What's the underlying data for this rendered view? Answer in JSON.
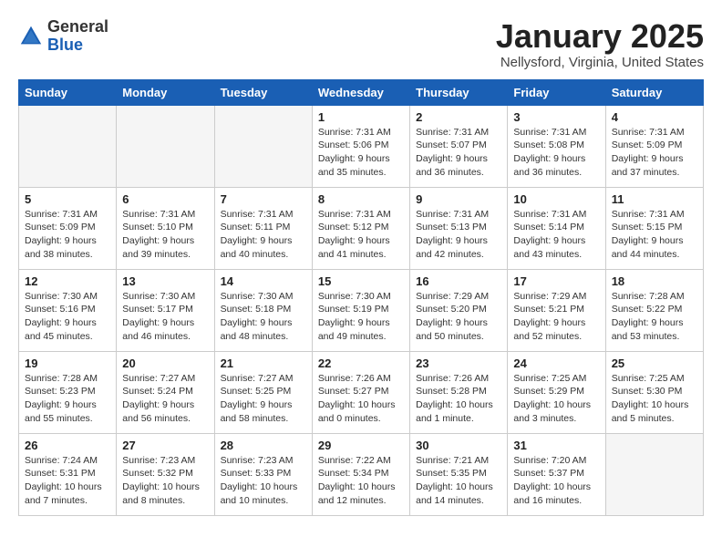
{
  "header": {
    "logo_general": "General",
    "logo_blue": "Blue",
    "month_title": "January 2025",
    "location": "Nellysford, Virginia, United States"
  },
  "days_of_week": [
    "Sunday",
    "Monday",
    "Tuesday",
    "Wednesday",
    "Thursday",
    "Friday",
    "Saturday"
  ],
  "weeks": [
    [
      {
        "day": "",
        "info": ""
      },
      {
        "day": "",
        "info": ""
      },
      {
        "day": "",
        "info": ""
      },
      {
        "day": "1",
        "info": "Sunrise: 7:31 AM\nSunset: 5:06 PM\nDaylight: 9 hours and 35 minutes."
      },
      {
        "day": "2",
        "info": "Sunrise: 7:31 AM\nSunset: 5:07 PM\nDaylight: 9 hours and 36 minutes."
      },
      {
        "day": "3",
        "info": "Sunrise: 7:31 AM\nSunset: 5:08 PM\nDaylight: 9 hours and 36 minutes."
      },
      {
        "day": "4",
        "info": "Sunrise: 7:31 AM\nSunset: 5:09 PM\nDaylight: 9 hours and 37 minutes."
      }
    ],
    [
      {
        "day": "5",
        "info": "Sunrise: 7:31 AM\nSunset: 5:09 PM\nDaylight: 9 hours and 38 minutes."
      },
      {
        "day": "6",
        "info": "Sunrise: 7:31 AM\nSunset: 5:10 PM\nDaylight: 9 hours and 39 minutes."
      },
      {
        "day": "7",
        "info": "Sunrise: 7:31 AM\nSunset: 5:11 PM\nDaylight: 9 hours and 40 minutes."
      },
      {
        "day": "8",
        "info": "Sunrise: 7:31 AM\nSunset: 5:12 PM\nDaylight: 9 hours and 41 minutes."
      },
      {
        "day": "9",
        "info": "Sunrise: 7:31 AM\nSunset: 5:13 PM\nDaylight: 9 hours and 42 minutes."
      },
      {
        "day": "10",
        "info": "Sunrise: 7:31 AM\nSunset: 5:14 PM\nDaylight: 9 hours and 43 minutes."
      },
      {
        "day": "11",
        "info": "Sunrise: 7:31 AM\nSunset: 5:15 PM\nDaylight: 9 hours and 44 minutes."
      }
    ],
    [
      {
        "day": "12",
        "info": "Sunrise: 7:30 AM\nSunset: 5:16 PM\nDaylight: 9 hours and 45 minutes."
      },
      {
        "day": "13",
        "info": "Sunrise: 7:30 AM\nSunset: 5:17 PM\nDaylight: 9 hours and 46 minutes."
      },
      {
        "day": "14",
        "info": "Sunrise: 7:30 AM\nSunset: 5:18 PM\nDaylight: 9 hours and 48 minutes."
      },
      {
        "day": "15",
        "info": "Sunrise: 7:30 AM\nSunset: 5:19 PM\nDaylight: 9 hours and 49 minutes."
      },
      {
        "day": "16",
        "info": "Sunrise: 7:29 AM\nSunset: 5:20 PM\nDaylight: 9 hours and 50 minutes."
      },
      {
        "day": "17",
        "info": "Sunrise: 7:29 AM\nSunset: 5:21 PM\nDaylight: 9 hours and 52 minutes."
      },
      {
        "day": "18",
        "info": "Sunrise: 7:28 AM\nSunset: 5:22 PM\nDaylight: 9 hours and 53 minutes."
      }
    ],
    [
      {
        "day": "19",
        "info": "Sunrise: 7:28 AM\nSunset: 5:23 PM\nDaylight: 9 hours and 55 minutes."
      },
      {
        "day": "20",
        "info": "Sunrise: 7:27 AM\nSunset: 5:24 PM\nDaylight: 9 hours and 56 minutes."
      },
      {
        "day": "21",
        "info": "Sunrise: 7:27 AM\nSunset: 5:25 PM\nDaylight: 9 hours and 58 minutes."
      },
      {
        "day": "22",
        "info": "Sunrise: 7:26 AM\nSunset: 5:27 PM\nDaylight: 10 hours and 0 minutes."
      },
      {
        "day": "23",
        "info": "Sunrise: 7:26 AM\nSunset: 5:28 PM\nDaylight: 10 hours and 1 minute."
      },
      {
        "day": "24",
        "info": "Sunrise: 7:25 AM\nSunset: 5:29 PM\nDaylight: 10 hours and 3 minutes."
      },
      {
        "day": "25",
        "info": "Sunrise: 7:25 AM\nSunset: 5:30 PM\nDaylight: 10 hours and 5 minutes."
      }
    ],
    [
      {
        "day": "26",
        "info": "Sunrise: 7:24 AM\nSunset: 5:31 PM\nDaylight: 10 hours and 7 minutes."
      },
      {
        "day": "27",
        "info": "Sunrise: 7:23 AM\nSunset: 5:32 PM\nDaylight: 10 hours and 8 minutes."
      },
      {
        "day": "28",
        "info": "Sunrise: 7:23 AM\nSunset: 5:33 PM\nDaylight: 10 hours and 10 minutes."
      },
      {
        "day": "29",
        "info": "Sunrise: 7:22 AM\nSunset: 5:34 PM\nDaylight: 10 hours and 12 minutes."
      },
      {
        "day": "30",
        "info": "Sunrise: 7:21 AM\nSunset: 5:35 PM\nDaylight: 10 hours and 14 minutes."
      },
      {
        "day": "31",
        "info": "Sunrise: 7:20 AM\nSunset: 5:37 PM\nDaylight: 10 hours and 16 minutes."
      },
      {
        "day": "",
        "info": ""
      }
    ]
  ]
}
